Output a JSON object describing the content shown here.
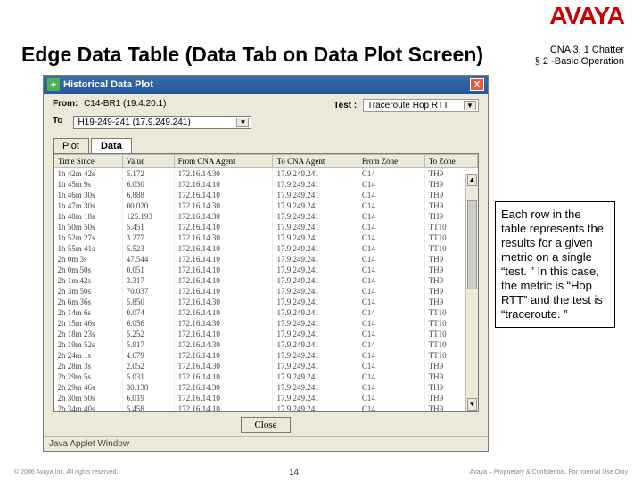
{
  "brand": "AVAYA",
  "slide_title": "Edge Data Table (Data Tab on Data Plot Screen)",
  "subtitle_l1": "CNA 3. 1 Chatter",
  "subtitle_l2": "§ 2 -Basic Operation",
  "window": {
    "title": "Historical Data Plot",
    "from_label": "From:",
    "from_value": "C14-BR1 (19.4.20.1)",
    "test_label": "Test :",
    "test_value": "Traceroute   Hop RTT",
    "to_label": "To",
    "to_value": "H19-249-241 (17.9.249.241)",
    "tabs": {
      "plot": "Plot",
      "data": "Data"
    },
    "headers": {
      "time": "Time Since",
      "val": "Value",
      "from_agent": "From CNA Agent",
      "to_agent": "To CNA Agent",
      "from_zone": "From Zone",
      "to_zone": "To Zone"
    },
    "rows": [
      {
        "t": "1h 42m 42s",
        "v": "5.172",
        "fa": "172.16.14.30",
        "ta": "17.9.249.241",
        "fz": "C14",
        "tz": "TH9"
      },
      {
        "t": "1h 45m 9s",
        "v": "6.030",
        "fa": "172.16.14.10",
        "ta": "17.9.249.241",
        "fz": "C14",
        "tz": "TH9"
      },
      {
        "t": "1h 46m 30s",
        "v": "6.888",
        "fa": "172.16.14.10",
        "ta": "17.9.249.241",
        "fz": "C14",
        "tz": "TH9"
      },
      {
        "t": "1h 47m 30s",
        "v": "00.020",
        "fa": "172.16.14.30",
        "ta": "17.9.249.241",
        "fz": "C14",
        "tz": "TH9"
      },
      {
        "t": "1h 48m 18s",
        "v": "125.193",
        "fa": "172.16.14.30",
        "ta": "17.9.249.241",
        "fz": "C14",
        "tz": "TH9"
      },
      {
        "t": "1h 50m 50s",
        "v": "5.451",
        "fa": "172.16.14.10",
        "ta": "17.9.249.241",
        "fz": "C14",
        "tz": "TT10"
      },
      {
        "t": "1h 52m 27s",
        "v": "3.277",
        "fa": "172.16.14.30",
        "ta": "17.9.249.241",
        "fz": "C14",
        "tz": "TT10"
      },
      {
        "t": "1h 55m 41s",
        "v": "5.523",
        "fa": "172.16.14.10",
        "ta": "17.9.249.241",
        "fz": "C14",
        "tz": "TT10"
      },
      {
        "t": "2h 0m 3s",
        "v": "47.544",
        "fa": "172.16.14.10",
        "ta": "17.9.249.241",
        "fz": "C14",
        "tz": "TH9"
      },
      {
        "t": "2h 0m 50s",
        "v": "0.051",
        "fa": "172.16.14.10",
        "ta": "17.9.249.241",
        "fz": "C14",
        "tz": "TH9"
      },
      {
        "t": "2h 1m 42s",
        "v": "3.317",
        "fa": "172.16.14.10",
        "ta": "17.9.249.241",
        "fz": "C14",
        "tz": "TH9"
      },
      {
        "t": "2h 3m 50s",
        "v": "70.037",
        "fa": "172.16.14.10",
        "ta": "17.9.249.241",
        "fz": "C14",
        "tz": "TH9"
      },
      {
        "t": "2h 6m 36s",
        "v": "5.850",
        "fa": "172.16.14.30",
        "ta": "17.9.249.241",
        "fz": "C14",
        "tz": "TH9"
      },
      {
        "t": "2h 14m 6s",
        "v": "0.074",
        "fa": "172.16.14.10",
        "ta": "17.9.249.241",
        "fz": "C14",
        "tz": "TT10"
      },
      {
        "t": "2h 15m 46s",
        "v": "6.056",
        "fa": "172.16.14.30",
        "ta": "17.9.249.241",
        "fz": "C14",
        "tz": "TT10"
      },
      {
        "t": "2h 18m 23s",
        "v": "5.252",
        "fa": "172.16.14.10",
        "ta": "17.9.249.241",
        "fz": "C14",
        "tz": "TT10"
      },
      {
        "t": "2h 19m 52s",
        "v": "5.917",
        "fa": "172.16.14.30",
        "ta": "17.9.249.241",
        "fz": "C14",
        "tz": "TT10"
      },
      {
        "t": "2h 24m 1s",
        "v": "4.679",
        "fa": "172.16.14.10",
        "ta": "17.9.249.241",
        "fz": "C14",
        "tz": "TT10"
      },
      {
        "t": "2h 28m 3s",
        "v": "2.052",
        "fa": "172.16.14.30",
        "ta": "17.9.249.241",
        "fz": "C14",
        "tz": "TH9"
      },
      {
        "t": "2h 29m 5s",
        "v": "5.031",
        "fa": "172.16.14.10",
        "ta": "17.9.249.241",
        "fz": "C14",
        "tz": "TH9"
      },
      {
        "t": "2h 29m 46s",
        "v": "30.138",
        "fa": "172.16.14.30",
        "ta": "17.9.249.241",
        "fz": "C14",
        "tz": "TH9"
      },
      {
        "t": "2h 30m 50s",
        "v": "6.019",
        "fa": "172.16.14.10",
        "ta": "17.9.249.241",
        "fz": "C14",
        "tz": "TH9"
      },
      {
        "t": "2h 34m 40s",
        "v": "5.458",
        "fa": "172.16.14.10",
        "ta": "17.9.249.241",
        "fz": "C14",
        "tz": "TH9"
      }
    ],
    "close_btn": "Close",
    "status": "Java Applet Window"
  },
  "callout": "Each row in the table  represents the results for a given metric on a single “test. ” In this case, the metric is “Hop RTT” and the test is “traceroute. ”",
  "footer": {
    "left": "© 2006 Avaya Inc. All rights reserved.",
    "page": "14",
    "right": "Avaya – Proprietary & Confidential.  For Internal Use Only"
  }
}
